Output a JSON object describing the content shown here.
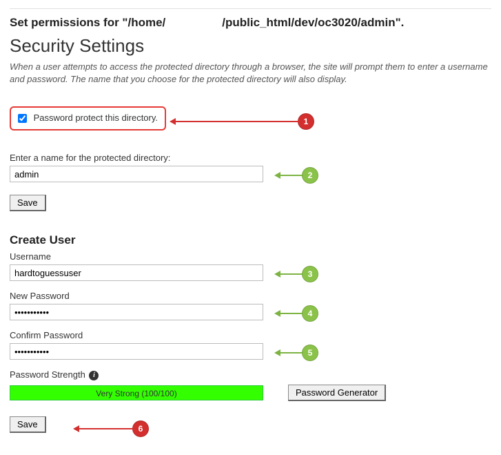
{
  "page": {
    "title_prefix": "Set permissions for \"/home/",
    "title_suffix": "/public_html/dev/oc3020/admin\".",
    "section": "Security Settings",
    "description": "When a user attempts to access the protected directory through a browser, the site will prompt them to enter a username and password. The name that you choose for the protected directory will also display."
  },
  "protect": {
    "label": "Password protect this directory."
  },
  "dir_name": {
    "label": "Enter a name for the protected directory:",
    "value": "admin"
  },
  "buttons": {
    "save": "Save",
    "password_generator": "Password Generator"
  },
  "create_user": {
    "heading": "Create User",
    "username_label": "Username",
    "username_value": "hardtoguessuser",
    "newpw_label": "New Password",
    "newpw_value": "•••••••••••",
    "confirmpw_label": "Confirm Password",
    "confirmpw_value": "•••••••••••",
    "strength_label": "Password Strength",
    "strength_text": "Very Strong (100/100)"
  },
  "annotations": {
    "b1": "1",
    "b2": "2",
    "b3": "3",
    "b4": "4",
    "b5": "5",
    "b6": "6"
  }
}
